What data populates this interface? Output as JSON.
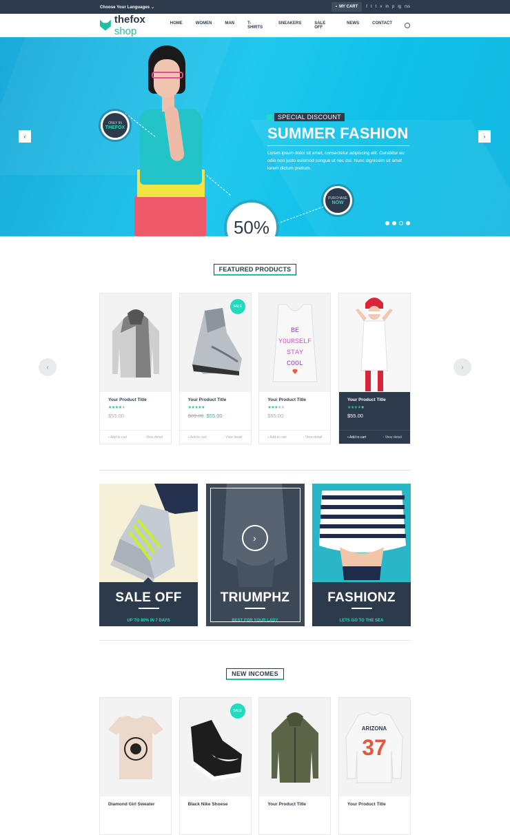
{
  "topbar": {
    "language": "Choose Your Languages",
    "cart": "MY CART",
    "social": [
      "f",
      "t",
      "t",
      "v",
      "in",
      "p",
      "ig",
      "rss"
    ]
  },
  "nav": {
    "logo_bold": "thefox",
    "logo_light": "shop",
    "menu": [
      "HOME",
      "WOMEN",
      "MAN",
      "T-SHIRTS",
      "SNEAKERS",
      "SALE OFF",
      "NEWS",
      "CONTACT"
    ]
  },
  "hero": {
    "badge_small": "ONLY IN",
    "badge_big": "THEFOX",
    "purchase_small": "PURCHASE",
    "purchase_big": "NOW",
    "percent": "50%",
    "tag": "SPECIAL DISCOUNT",
    "title": "SUMMER FASHION",
    "text": "Lorem ipsum dolor sit amet, consectetur adipiscing elit. Curabitur eu odio non justo euismod congue ut nec dui. Nunc dignissim sit amet lorem dictum pretium.",
    "prev": "‹",
    "next": "›",
    "slides": 4,
    "active_slide": 3
  },
  "featured": {
    "heading": "FEATURED PRODUCTS",
    "products": [
      {
        "title": "Your Product Title",
        "rating": 4,
        "price": "$55.00",
        "old_price": "",
        "sale": ""
      },
      {
        "title": "Your Product Title",
        "rating": 5,
        "price": "$55.00",
        "old_price": "$89.00",
        "sale": "SALE"
      },
      {
        "title": "Your Product Title",
        "rating": 4,
        "price": "$55.00",
        "old_price": "",
        "sale": ""
      },
      {
        "title": "Your Product Title",
        "rating": 4,
        "price": "$55.00",
        "old_price": "",
        "sale": ""
      }
    ],
    "add_to_cart": "Add to cart",
    "view_detail": "View detail",
    "shirt_text": "BE YOURSELF STAY COOL"
  },
  "banners": [
    {
      "title": "SALE OFF",
      "subtitle": "UP TO 80% IN 7 DAYS"
    },
    {
      "title": "TRIUMPHZ",
      "subtitle": "BEST FOR YOUR LADY"
    },
    {
      "title": "FASHIONZ",
      "subtitle": "LETS GO TO THE SEA"
    }
  ],
  "new_incomes": {
    "heading": "NEW INCOMES",
    "products": [
      {
        "title": "Diamond Girl Sweater",
        "sale": ""
      },
      {
        "title": "Black Nike Shoese",
        "sale": "SALE"
      },
      {
        "title": "Your Product Title",
        "sale": ""
      },
      {
        "title": "Your Product Title",
        "sale": ""
      }
    ],
    "sweater_text": "ARIZONA 37"
  },
  "colors": {
    "navy": "#2c3a4b",
    "teal": "#1fbfa3",
    "hero": "#22c8ee"
  }
}
